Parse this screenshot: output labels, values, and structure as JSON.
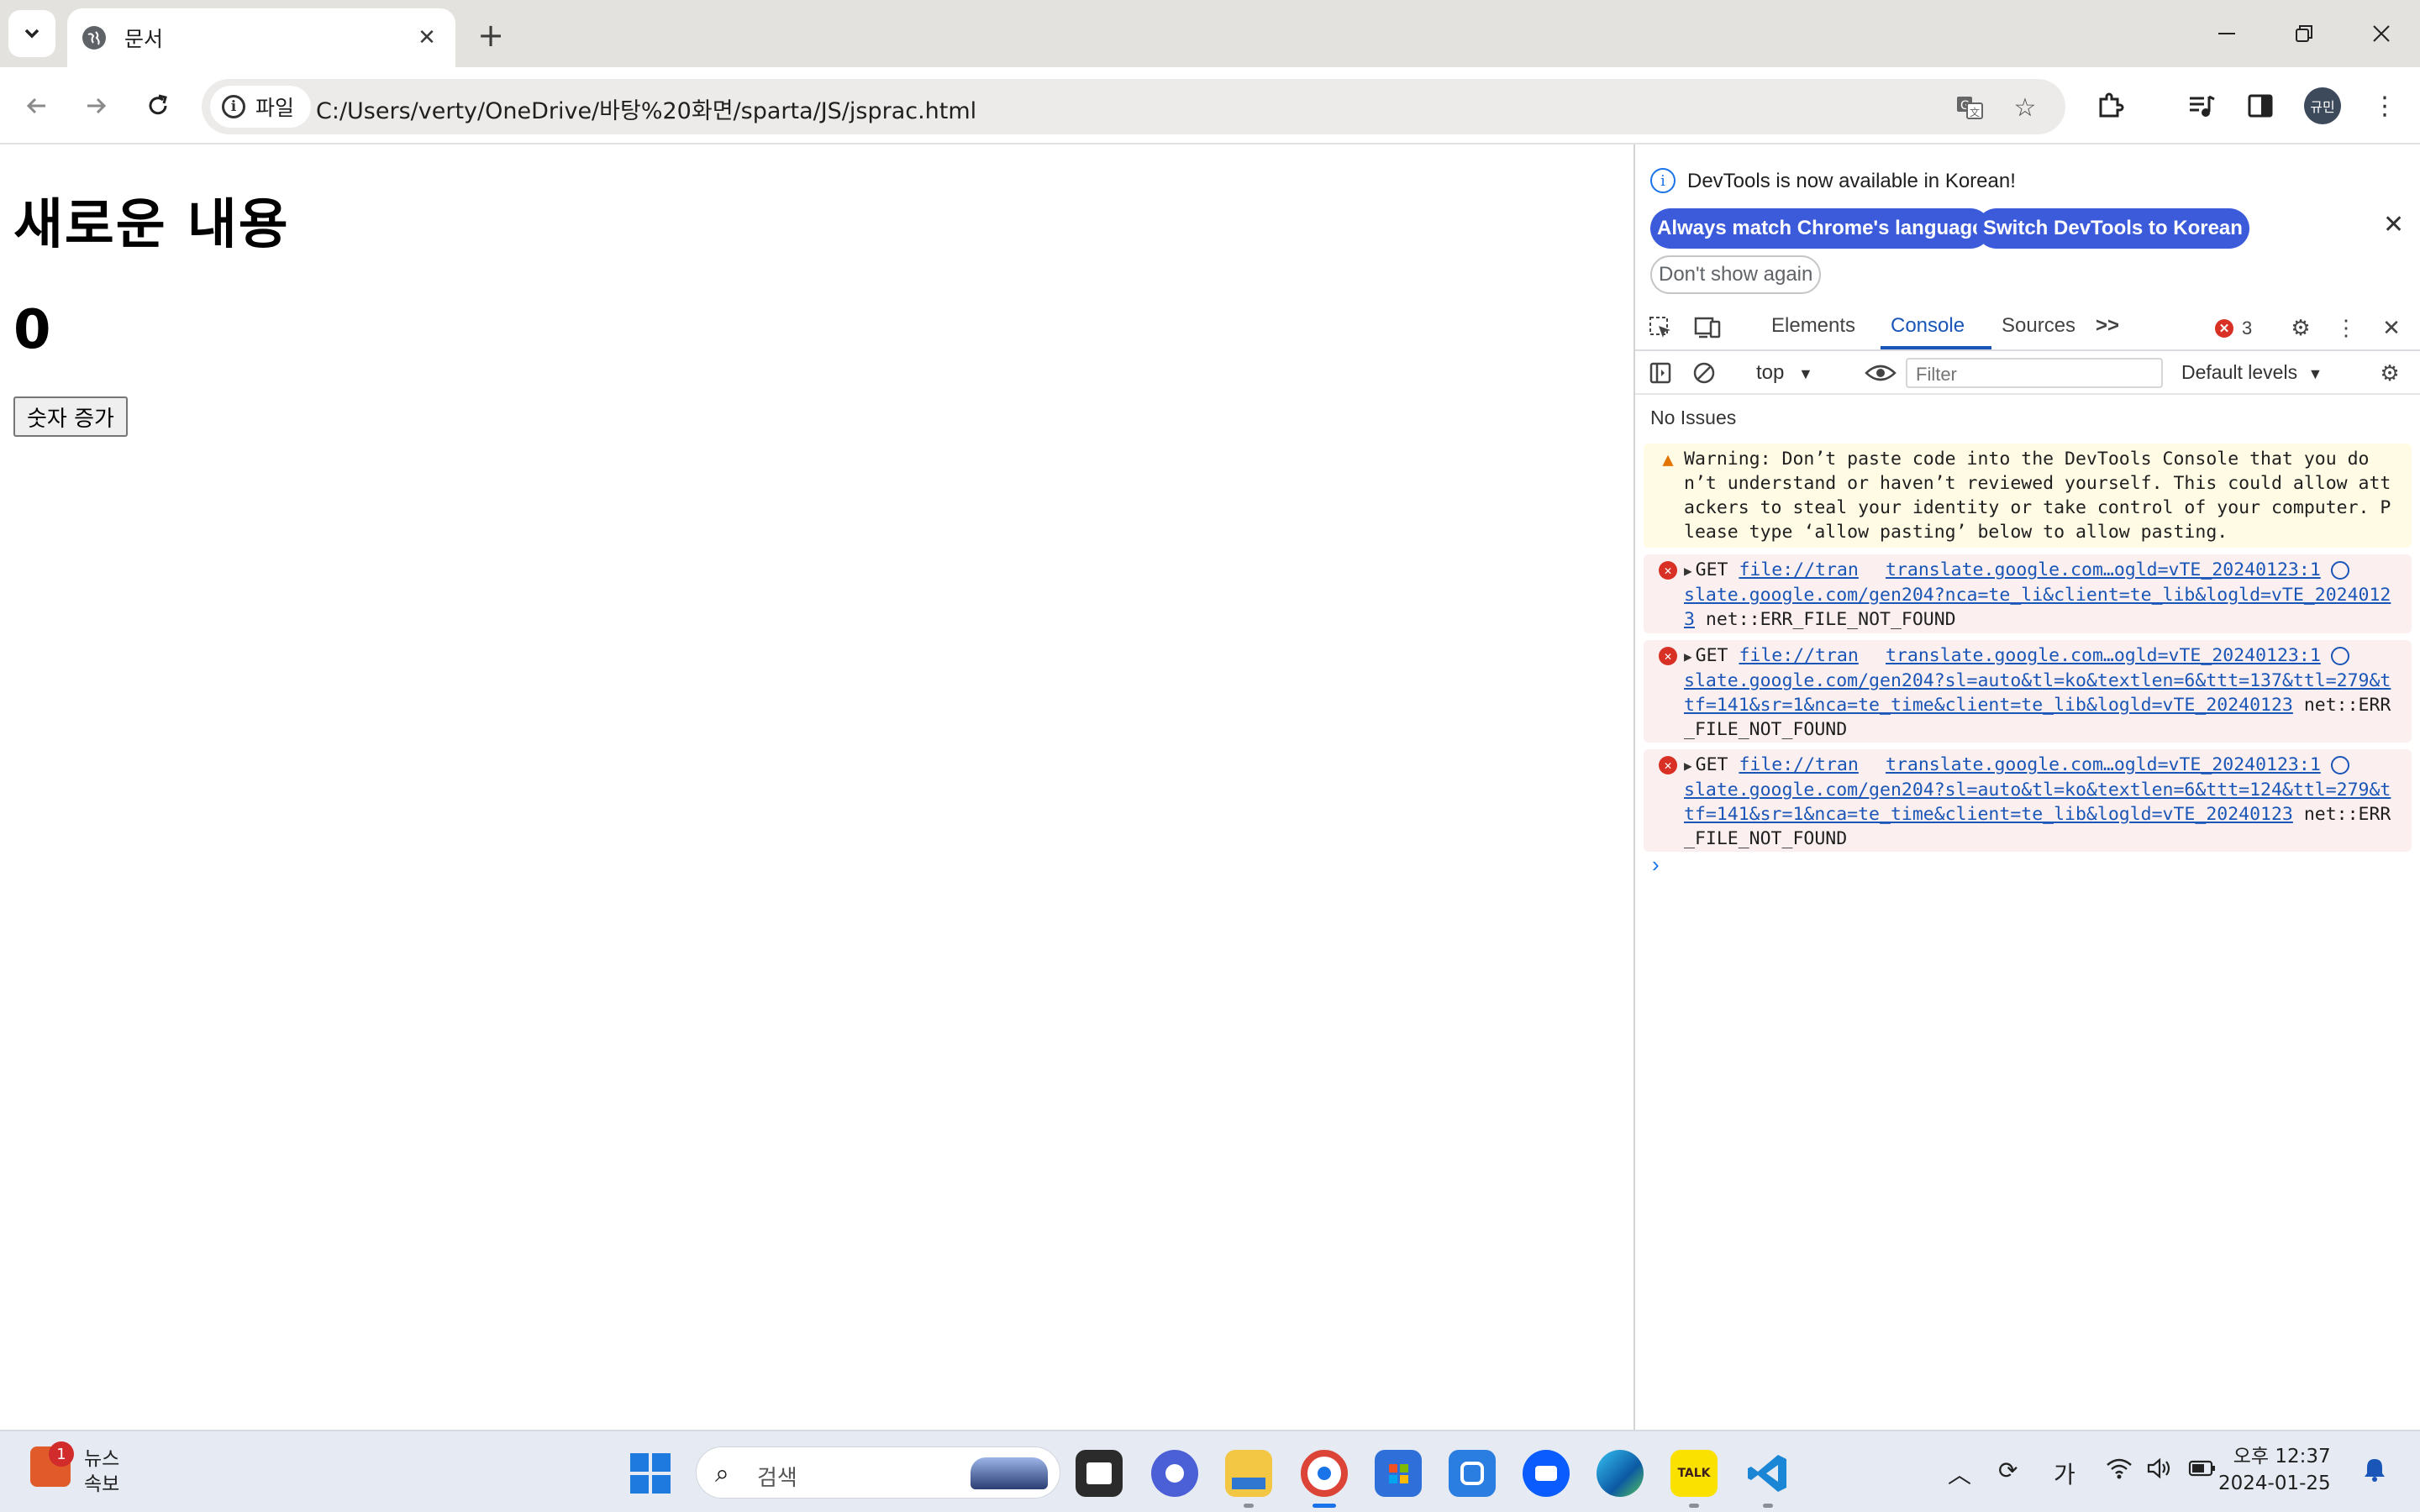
{
  "browser": {
    "tab_title": "문서",
    "site_chip_label": "파일",
    "url": "C:/Users/verty/OneDrive/바탕%20화면/sparta/JS/jsprac.html",
    "profile_initials": "규민"
  },
  "page": {
    "heading": "새로운 내용",
    "counter": "0",
    "button_label": "숫자 증가"
  },
  "devtools": {
    "info_message": "DevTools is now available in Korean!",
    "btn_match_language": "Always match Chrome's language",
    "btn_switch_korean": "Switch DevTools to Korean",
    "btn_dont_show": "Don't show again",
    "tabs": [
      "Elements",
      "Console",
      "Sources"
    ],
    "active_tab": "Console",
    "more_tabs": ">>",
    "error_count": "3",
    "context": "top",
    "filter_placeholder": "Filter",
    "levels": "Default levels",
    "no_issues": "No Issues",
    "warning": "Warning: Don’t paste code into the DevTools Console that you don’t understand or haven’t reviewed yourself. This could allow attackers to steal your identity or take control of your computer. Please type ‘allow pasting’ below to allow pasting.",
    "errors": [
      {
        "method": "GET",
        "url_start": "file://tran",
        "source": "translate.google.com…ogld=vTE_20240123:1",
        "url_rest": "slate.google.com/gen204?nca=te_li&client=te_lib&logld=vTE_20240123",
        "status": "net::ERR_FILE_NOT_FOUND"
      },
      {
        "method": "GET",
        "url_start": "file://tran",
        "source": "translate.google.com…ogld=vTE_20240123:1",
        "url_rest": "slate.google.com/gen204?sl=auto&tl=ko&textlen=6&ttt=137&ttl=279&ttf=141&sr=1&nca=te_time&client=te_lib&logld=vTE_20240123",
        "status": "net::ERR_FILE_NOT_FOUND"
      },
      {
        "method": "GET",
        "url_start": "file://tran",
        "source": "translate.google.com…ogld=vTE_20240123:1",
        "url_rest": "slate.google.com/gen204?sl=auto&tl=ko&textlen=6&ttt=124&ttl=279&ttf=141&sr=1&nca=te_time&client=te_lib&logld=vTE_20240123",
        "status": "net::ERR_FILE_NOT_FOUND"
      }
    ]
  },
  "taskbar": {
    "news_badge": "1",
    "news_line1": "뉴스",
    "news_line2": "속보",
    "search_placeholder": "검색",
    "ime_label": "가",
    "clock_time": "오후 12:37",
    "clock_date": "2024-01-25",
    "kakao_label": "TALK"
  }
}
